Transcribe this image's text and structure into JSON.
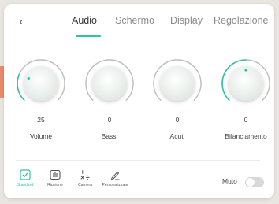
{
  "tabs": [
    {
      "label": "Audio",
      "active": true
    },
    {
      "label": "Schermo",
      "active": false
    },
    {
      "label": "Display",
      "active": false
    },
    {
      "label": "Regolazione",
      "active": false
    }
  ],
  "knobs": [
    {
      "label": "Volume",
      "value": "25",
      "level": 0.25
    },
    {
      "label": "Bassi",
      "value": "0",
      "level": 0
    },
    {
      "label": "Acuti",
      "value": "0",
      "level": 0
    },
    {
      "label": "Bilanciamento",
      "value": "0",
      "level": 0.5
    }
  ],
  "modes": [
    {
      "label": "Standard",
      "icon": "check-square-icon",
      "active": true
    },
    {
      "label": "Riunione",
      "icon": "meeting-icon",
      "active": false
    },
    {
      "label": "Camera",
      "icon": "math-operators-icon",
      "active": false
    },
    {
      "label": "Personalizzate",
      "icon": "pen-icon",
      "active": false
    }
  ],
  "mute": {
    "label": "Muto",
    "on": false
  },
  "colors": {
    "accent": "#2ec4a0",
    "track": "#bdbdbd",
    "background": "#e9e5e1"
  }
}
